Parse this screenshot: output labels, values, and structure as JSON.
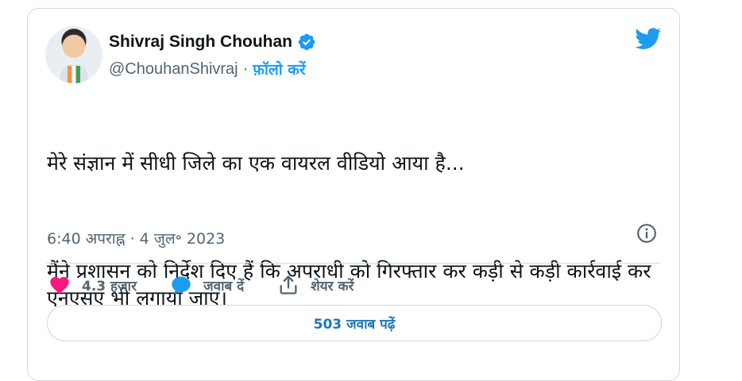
{
  "author": {
    "name": "Shivraj Singh Chouhan",
    "handle": "@ChouhanShivraj",
    "separator": "·",
    "follow_label": "फ़ॉलो करें"
  },
  "tweet": {
    "paragraph_1": "मेरे संज्ञान में सीधी जिले का एक वायरल वीडियो आया है...",
    "paragraph_2": "मैंने प्रशासन को निर्देश दिए हैं कि अपराधी को गिरफ्तार कर कड़ी से कड़ी कार्रवाई कर एनएसए भी लगाया जाए।",
    "time": "6:40 अपराह्न",
    "date": "4 जुल॰ 2023",
    "meta_separator": " · "
  },
  "actions": {
    "likes_label": "4.3 हज़ार",
    "reply_label": "जवाब दें",
    "share_label": "शेयर करें"
  },
  "replies_button": {
    "label": "503 जवाब पढ़ें"
  },
  "colors": {
    "accent": "#1d9bf0",
    "like": "#f91880",
    "muted_text": "#536471",
    "border": "#cfd9de"
  },
  "icons": [
    "verified-badge-icon",
    "twitter-bird-icon",
    "info-icon",
    "heart-icon",
    "reply-bubble-icon",
    "share-icon"
  ]
}
